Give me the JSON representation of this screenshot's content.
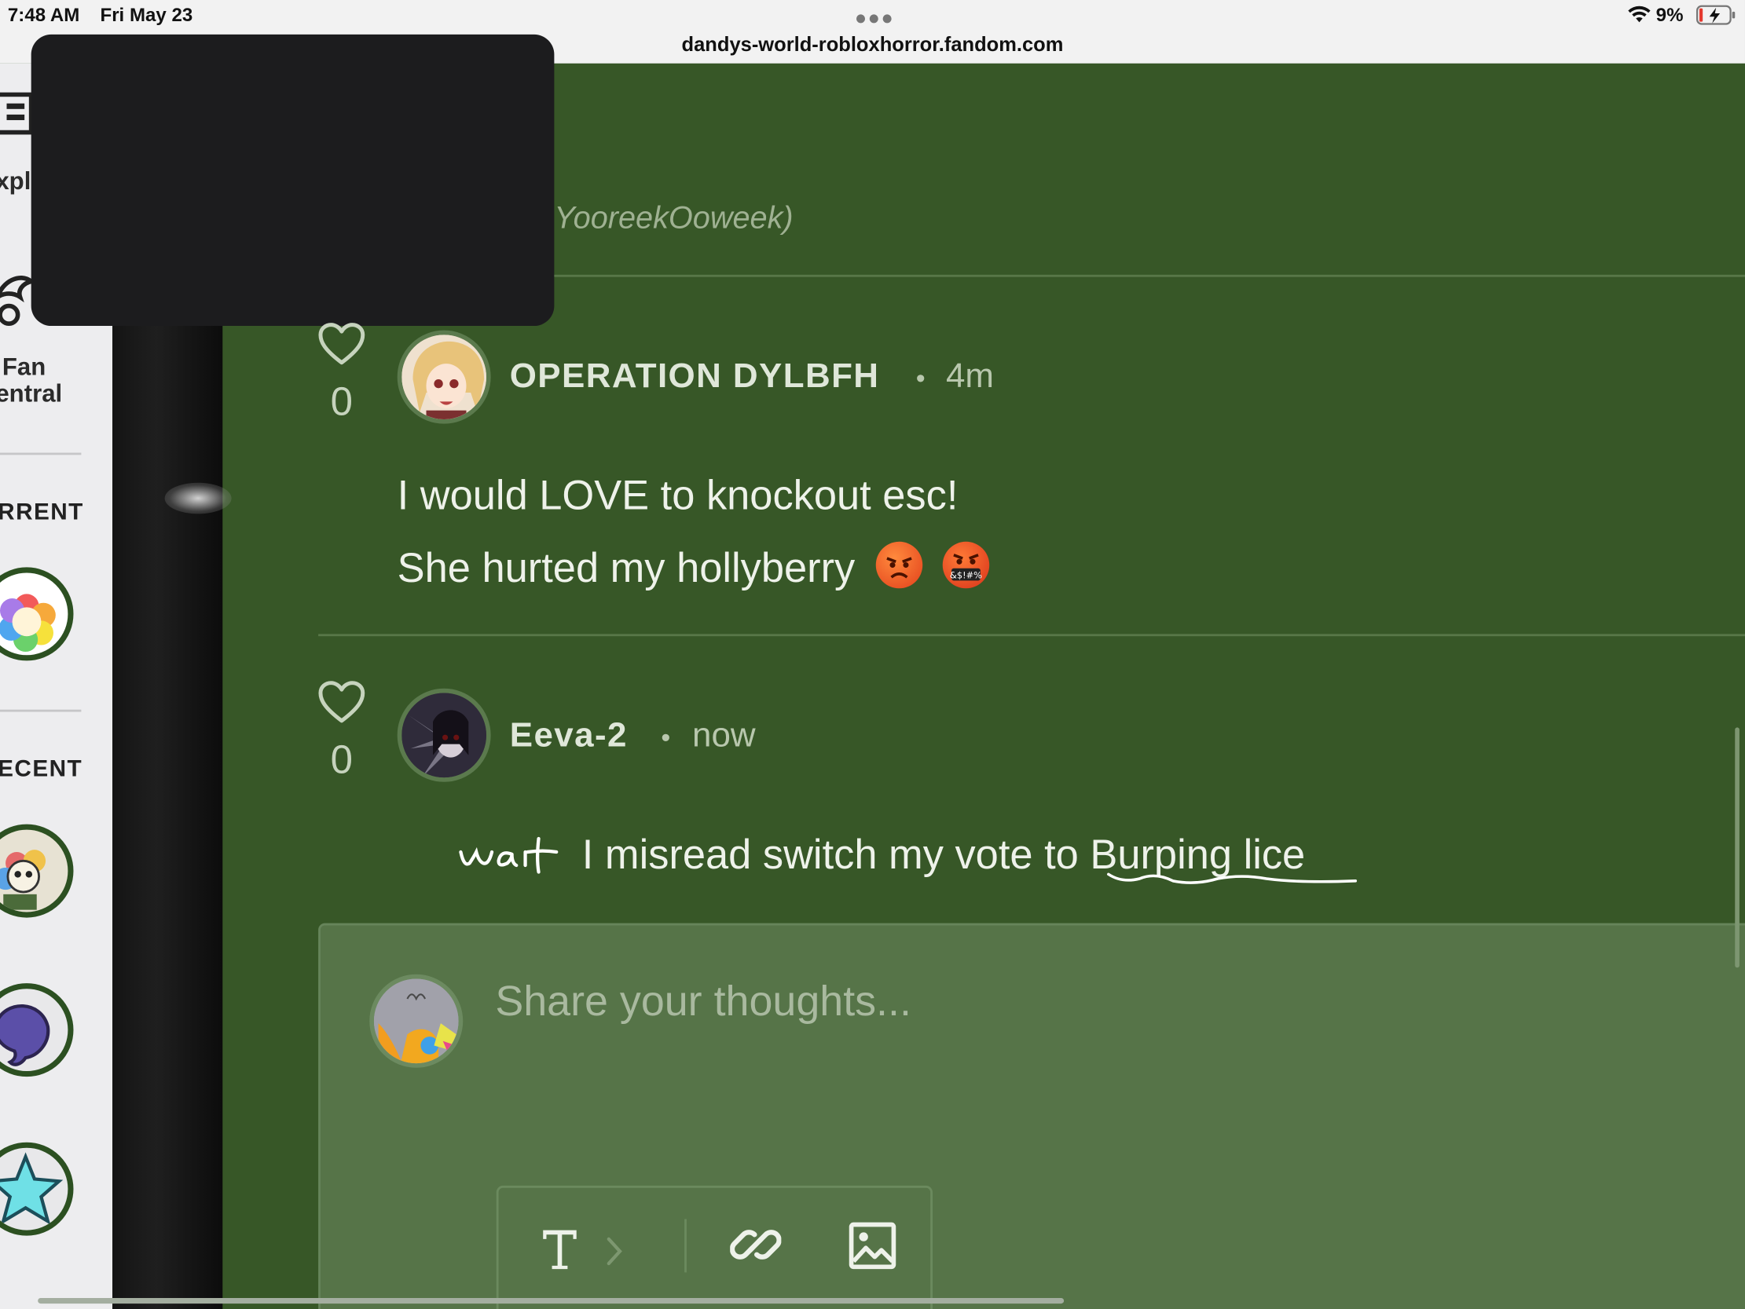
{
  "status_bar": {
    "time": "7:48 AM",
    "date": "Fri May 23",
    "url": "dandys-world-robloxhorror.fandom.com",
    "battery_percent": "9%"
  },
  "sidebar": {
    "explore_label": "xpl",
    "fan_central_line1": "Fan",
    "fan_central_line2": "entral",
    "current_label": "RRENT",
    "recent_label": "ECENT"
  },
  "previous_comment": {
    "signature_fragment": "YooreekOoweek)"
  },
  "comments": [
    {
      "likes": "0",
      "username": "OPERATION DYLBFH",
      "separator": "•",
      "time": "4m",
      "line1": "I would LOVE to knockout esc!",
      "line2": "She hurted my hollyberry",
      "emojis": [
        "angry-face",
        "cursing-face"
      ]
    },
    {
      "likes": "0",
      "username": "Eeva-2",
      "separator": "•",
      "time": "now",
      "handwritten": "wait",
      "text": "I misread switch my vote to Burping lice"
    }
  ],
  "composer": {
    "placeholder": "Share your thoughts..."
  },
  "colors": {
    "page_bg": "#375727",
    "composer_bg": "#567448",
    "sidebar_bg": "#ededef"
  }
}
